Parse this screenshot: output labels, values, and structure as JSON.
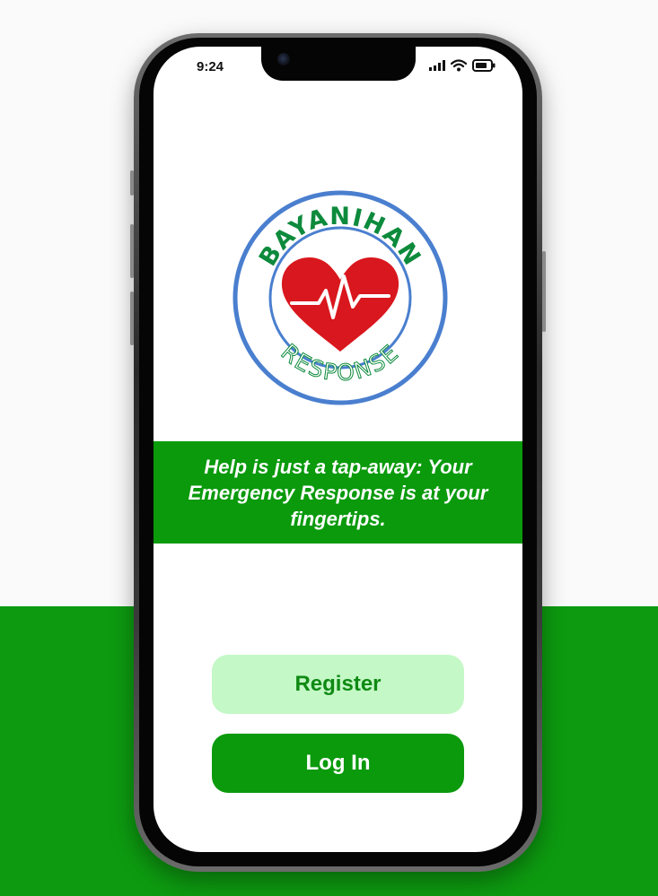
{
  "status_bar": {
    "time": "9:24",
    "icons": [
      "cellular-signal-icon",
      "wifi-icon",
      "battery-icon"
    ]
  },
  "logo": {
    "text_top": "BAYANIHAN",
    "text_bottom": "RESPONSE",
    "icon": "heart-pulse-icon",
    "colors": {
      "ring": "#4a7fcf",
      "text": "#0d8a3c",
      "heart": "#d9171e"
    }
  },
  "tagline": "Help is just a tap-away: Your Emergency Response is at your fingertips.",
  "buttons": {
    "register_label": "Register",
    "login_label": "Log In"
  },
  "colors": {
    "brand_green": "#0a9a0c",
    "register_bg": "#c4f8c6",
    "register_text": "#0f8a14"
  }
}
